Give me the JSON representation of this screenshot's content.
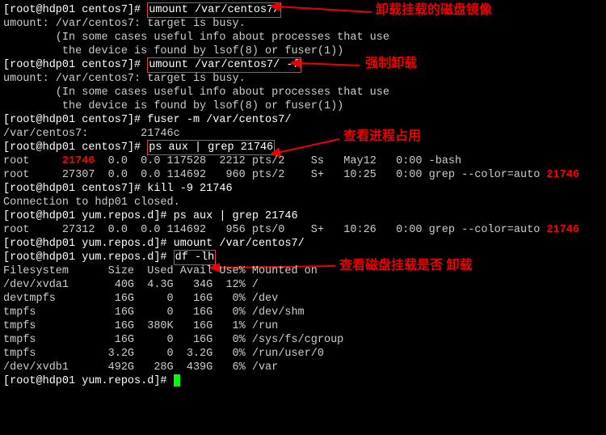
{
  "prompts": {
    "root_centos7": "[root@hdp01 centos7]# ",
    "root_yumrepos": "[root@hdp01 yum.repos.d]# "
  },
  "cmds": {
    "umount1": "umount /var/centos7/",
    "umount2": "umount /var/centos7/ -f",
    "fuser": "fuser -m /var/centos7/",
    "psgrep": "ps aux | grep 21746",
    "kill": "kill -9 21746",
    "psgrep2": "ps aux | grep 21746",
    "umount3": "umount /var/centos7/",
    "dflh": "df -lh"
  },
  "output": {
    "busy": "umount: /var/centos7: target is busy.",
    "busy_hint1": "        (In some cases useful info about processes that use",
    "busy_hint2": "         the device is found by lsof(8) or fuser(1))",
    "fuser_out": "/var/centos7:        21746c",
    "ps1_a_pre": "root     ",
    "ps1_a_pid": "21746",
    "ps1_a_post": "  0.0  0.0 117528  2212 pts/2    Ss   May12   0:00 -bash",
    "ps1_b_pre": "root     27307  0.0  0.0 114692   960 pts/2    S+   10:25   0:00 grep --color=auto ",
    "ps1_b_pid": "21746",
    "closed": "Connection to hdp01 closed.",
    "ps2_a_pre": "root     27312  0.0  0.0 114692   956 pts/0    S+   10:26   0:00 grep --color=auto ",
    "ps2_a_pid": "21746",
    "df_header": "Filesystem      Size  Used Avail Use% Mounted on",
    "df_rows": [
      "/dev/xvda1       40G  4.3G   34G  12% /",
      "devtmpfs         16G     0   16G   0% /dev",
      "tmpfs            16G     0   16G   0% /dev/shm",
      "tmpfs            16G  380K   16G   1% /run",
      "tmpfs            16G     0   16G   0% /sys/fs/cgroup",
      "tmpfs           3.2G     0  3.2G   0% /run/user/0",
      "/dev/xvdb1      492G   28G  439G   6% /var"
    ]
  },
  "annotations": {
    "a1": "卸载挂载的磁盘镜像",
    "a2": "强制卸载",
    "a3": "查看进程占用",
    "a4": "查看磁盘挂载是否 卸载"
  }
}
